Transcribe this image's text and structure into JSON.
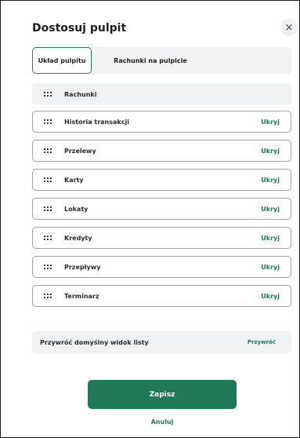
{
  "dialog": {
    "title": "Dostosuj pulpit",
    "close_icon": "×"
  },
  "tabs": [
    {
      "label": "Układ pulpitu",
      "active": true
    },
    {
      "label": "Rachunki na pulpicie",
      "active": false
    }
  ],
  "fixed_item": {
    "label": "Rachunki"
  },
  "items": [
    {
      "label": "Historia transakcji",
      "action": "Ukryj"
    },
    {
      "label": "Przelewy",
      "action": "Ukryj"
    },
    {
      "label": "Karty",
      "action": "Ukryj"
    },
    {
      "label": "Lokaty",
      "action": "Ukryj"
    },
    {
      "label": "Kredyty",
      "action": "Ukryj"
    },
    {
      "label": "Przepływy",
      "action": "Ukryj"
    },
    {
      "label": "Terminarz",
      "action": "Ukryj"
    }
  ],
  "restore": {
    "label": "Przywróć domyślny widok listy",
    "action": "Przywróć"
  },
  "footer": {
    "save_label": "Zapisz",
    "cancel_label": "Anuluj"
  },
  "colors": {
    "accent": "#1e7a55",
    "tab_active_border": "#2f7d5d",
    "row_border": "#9ca3ab",
    "muted_bg": "#f1f2f4"
  },
  "icons": {
    "close": "close-icon",
    "drag": "drag-handle-icon"
  }
}
